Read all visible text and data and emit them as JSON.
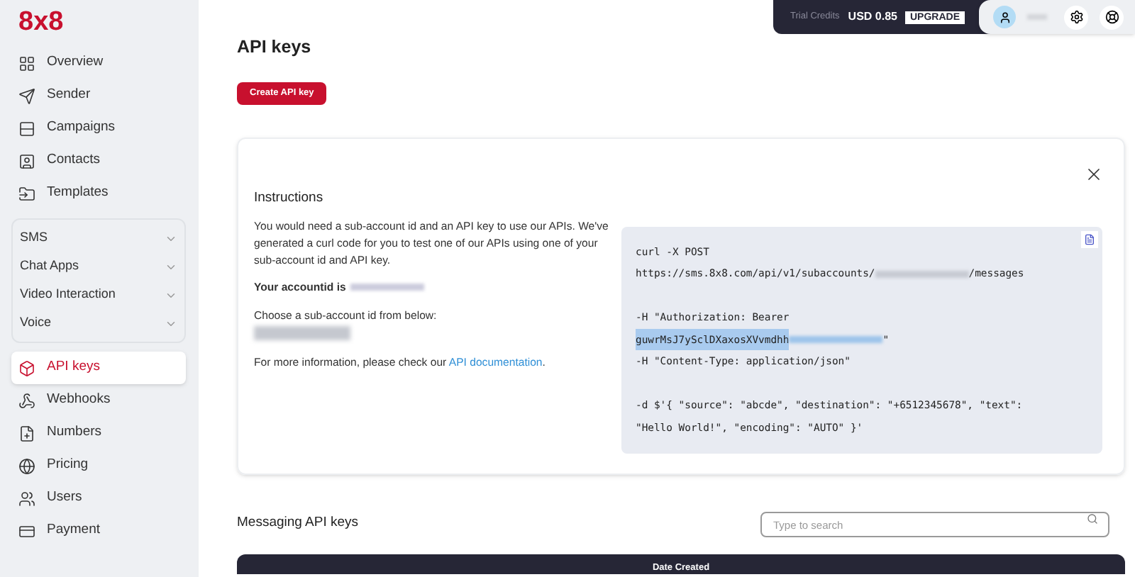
{
  "logo": "8x8",
  "sidebar": {
    "items": [
      {
        "kind": "link",
        "label": "Overview",
        "selected": false
      },
      {
        "kind": "link",
        "label": "Sender",
        "selected": false
      },
      {
        "kind": "link",
        "label": "Campaigns",
        "selected": false
      },
      {
        "kind": "link",
        "label": "Contacts",
        "selected": false
      },
      {
        "kind": "link",
        "label": "Templates",
        "selected": false
      },
      {
        "kind": "group",
        "items": [
          {
            "label": "SMS",
            "expanded": false
          },
          {
            "label": "Chat Apps",
            "expanded": false
          },
          {
            "label": "Video Interaction",
            "expanded": false
          },
          {
            "label": "Voice",
            "expanded": false
          }
        ]
      },
      {
        "kind": "link",
        "label": "API keys",
        "selected": true
      },
      {
        "kind": "link",
        "label": "Webhooks",
        "selected": false
      },
      {
        "kind": "link",
        "label": "Numbers",
        "selected": false
      },
      {
        "kind": "link",
        "label": "Pricing",
        "selected": false
      },
      {
        "kind": "link",
        "label": "Users",
        "selected": false
      },
      {
        "kind": "link",
        "label": "Payment",
        "selected": false
      }
    ]
  },
  "topbar": {
    "credits_label": "Trial Credits",
    "credits_value": "USD 0.85",
    "upgrade": "UPGRADE"
  },
  "page_title": "API keys",
  "create_button": "Create API key",
  "instructions": {
    "title": "Instructions",
    "intro": "You would need a sub-account id and an API key to use our APIs. We've generated a curl code for you to test one of our APIs using one of your sub-account id and API key.",
    "account_label": "Your accountid is",
    "choose_label": "Choose a sub-account id from below:",
    "more_info": "For more information, please check our",
    "link": "API documentation",
    "after_link": "."
  },
  "code_lines": [
    {
      "kind": "text",
      "segments": [
        {
          "kind": "text",
          "text": "curl -X POST"
        }
      ]
    },
    {
      "kind": "text",
      "segments": [
        {
          "kind": "text",
          "text": "https://sms.8x8.com/api/v1/subaccounts/"
        },
        {
          "kind": "redacted"
        },
        {
          "kind": "text",
          "text": "/messages"
        }
      ]
    },
    {
      "kind": "blank"
    },
    {
      "kind": "text",
      "segments": [
        {
          "kind": "text",
          "text": "-H \"Authorization: Bearer"
        }
      ]
    },
    {
      "kind": "text",
      "segments": [
        {
          "kind": "selected",
          "text": "guwrMsJ7ySclDXaxosXVvmdhh"
        },
        {
          "kind": "redacted"
        },
        {
          "kind": "text",
          "text": "\""
        }
      ]
    },
    {
      "kind": "text",
      "segments": [
        {
          "kind": "text",
          "text": "-H \"Content-Type: application/json\""
        }
      ]
    },
    {
      "kind": "blank"
    },
    {
      "kind": "text",
      "segments": [
        {
          "kind": "text",
          "text": "-d $'{ \"source\": \"abcde\", \"destination\": \"+6512345678\", \"text\":"
        }
      ]
    },
    {
      "kind": "text",
      "segments": [
        {
          "kind": "text",
          "text": "\"Hello World!\", \"encoding\": \"AUTO\" }'"
        }
      ]
    }
  ],
  "keys_section": {
    "title": "Messaging API keys",
    "search_placeholder": "Type to search",
    "table": {
      "columns": [
        "Date Created"
      ]
    }
  }
}
